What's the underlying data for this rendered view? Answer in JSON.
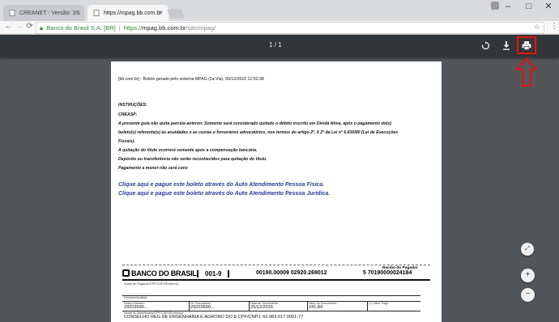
{
  "browser": {
    "tabs": [
      {
        "title": "CREANET - Versão: 1.1",
        "active": false
      },
      {
        "title": "https://mpag.bb.com.br",
        "active": true
      }
    ],
    "window_buttons": [
      "–",
      "□",
      "✕"
    ],
    "site_identity": "Banco do Brasil S.A. [BR]",
    "url_secure": "https://",
    "url_host": "mpag.bb.com.br",
    "url_path": "/site/mpag/",
    "nav": {
      "back": "←",
      "forward": "→",
      "reload": "⟳"
    }
  },
  "pdf_viewer": {
    "page_indicator": "1 / 1",
    "icons": {
      "rotate": "rotate-icon",
      "download": "download-icon",
      "print": "print-icon"
    },
    "highlight_color": "#e11111",
    "zoom": {
      "fit": "⤢",
      "in": "+",
      "out": "−"
    }
  },
  "document": {
    "header": "[bb.com.br] - Boleto gerado pelo sistema MPAG (2a Via). 09/12/2016 12:53:38",
    "instructions_title": "INSTRUÇÕES:",
    "creasp": "CREASP:",
    "lines": [
      "A presente guia não quita parcela anterior. Somente será considerado quitado o débito inscrito em Dívida Ativa, após o pagamento do(s)",
      "boleto(s) referente(s) às anuidades e as custas e honorários advocatícios, nos termos do artigo 2º, § 2º da Lei nº 6.830/80 (Lei de Execuções",
      "Fiscais).",
      "A quitação do título ocorrerá somente após a compensação bancária.",
      "Depósito ou transferência não serão reconhecidos para quitação do título.",
      "Pagamento a menor não será cons"
    ],
    "link_pf": "Clique aqui e pague este boleto através do Auto Atendimento Pessoa Física.",
    "link_pj": "Clique aqui e pague este boleto através do Auto Atendimento Pessoa Jurídica."
  },
  "boleto": {
    "recibo": "Recibo do Pagador",
    "bank_name": "BANCO DO BRASIL",
    "bank_code": "001-9",
    "line_part1": "00190.00009 02920.269012",
    "line_part2": "5 70190000024184",
    "lbl_pagador": "Nome do Pagador/CPF/CNPJ/Endereço",
    "lbl_sacador": "Sacador/Avalista",
    "lbl_nosso": "Nosso-Número",
    "val_nosso": "29202690...",
    "lbl_documento": "Nr. Documento",
    "val_documento": "29202690...",
    "lbl_vencimento": "Data de Vencimento",
    "val_vencimento": "25/12/2016",
    "lbl_valor": "Valor do Documento",
    "val_valor": "241,84",
    "lbl_pago": "(=) Valor Pago",
    "lbl_beneficiario": "Nome do Beneficiário/CPF/CNPJ/Endereço",
    "val_beneficiario": "CONSELHO REG DE ENGENHARIA E AGRONO DO E CPF/CNPJ: 60.983.017.0001-77"
  }
}
